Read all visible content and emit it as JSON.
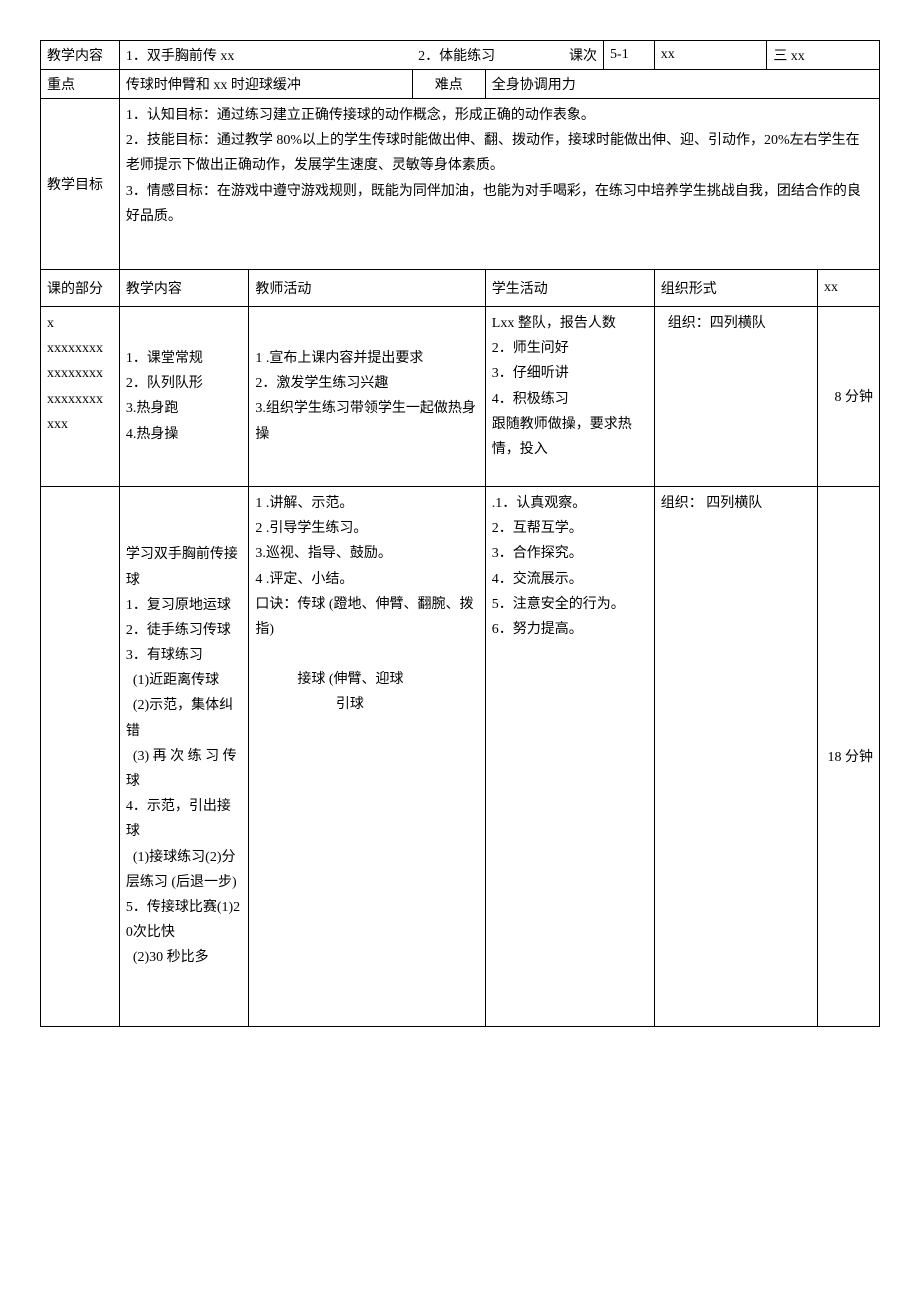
{
  "row1": {
    "label1": "教学内容",
    "content": "1．双手胸前传 xx",
    "subject": "2．体能练习",
    "label2": "课次",
    "val2": "5-1",
    "label3": "xx",
    "val3": "三 xx"
  },
  "row2": {
    "label1": "重点",
    "content1": "传球时伸臂和 xx 时迎球缓冲",
    "label2": "难点",
    "content2": "全身协调用力"
  },
  "row3": {
    "label": "教学目标",
    "content": "1．认知目标：通过练习建立正确传接球的动作概念，形成正确的动作表象。\n2．技能目标：通过教学 80%以上的学生传球时能做出伸、翻、拨动作，接球时能做出伸、迎、引动作，20%左右学生在老师提示下做出正确动作，发展学生速度、灵敏等身体素质。\n3．情感目标：在游戏中遵守游戏规则，既能为同伴加油，也能为对手喝彩，在练习中培养学生挑战自我，团结合作的良好品质。"
  },
  "headers": {
    "h1": "课的部分",
    "h2": "教学内容",
    "h3": "教师活动",
    "h4": "学生活动",
    "h5": "组织形式",
    "h6": "xx"
  },
  "section1": {
    "part": "x\nxxxxxxxx\nxxxxxxxx\nxxxxxxxx\nxxx",
    "content": "1．课堂常规\n2．队列队形\n3.热身跑\n4.热身操",
    "teacher": "1 .宣布上课内容并提出要求\n2．激发学生练习兴趣\n3.组织学生练习带领学生一起做热身操",
    "student": "Lxx 整队，报告人数\n2．师生问好\n3．仔细听讲\n4．积极练习\n跟随教师做操，要求热情，投入",
    "org": "  组织：四列横队",
    "time": "8 分钟"
  },
  "section2": {
    "part": "",
    "content": "学习双手胸前传接球\n1．复习原地运球\n2．徒手练习传球\n3．有球练习\n  (1)近距离传球\n  (2)示范，集体纠错\n  (3) 再 次 练 习 传球\n4．示范，引出接球\n  (1)接球练习(2)分层练习 (后退一步)\n5．传接球比赛(1)20次比快\n  (2)30 秒比多",
    "teacher": "1 .讲解、示范。\n2 .引导学生练习。\n3.巡视、指导、鼓励。\n4 .评定、小结。\n口诀：传球 (蹬地、伸臂、翻腕、拨指)\n\n            接球 (伸臂、迎球\n                       引球",
    "student": ".1．认真观察。\n2．互帮互学。\n3．合作探究。\n4．交流展示。\n5．注意安全的行为。\n6．努力提高。",
    "org": "组织： 四列横队",
    "time": "18 分钟"
  }
}
